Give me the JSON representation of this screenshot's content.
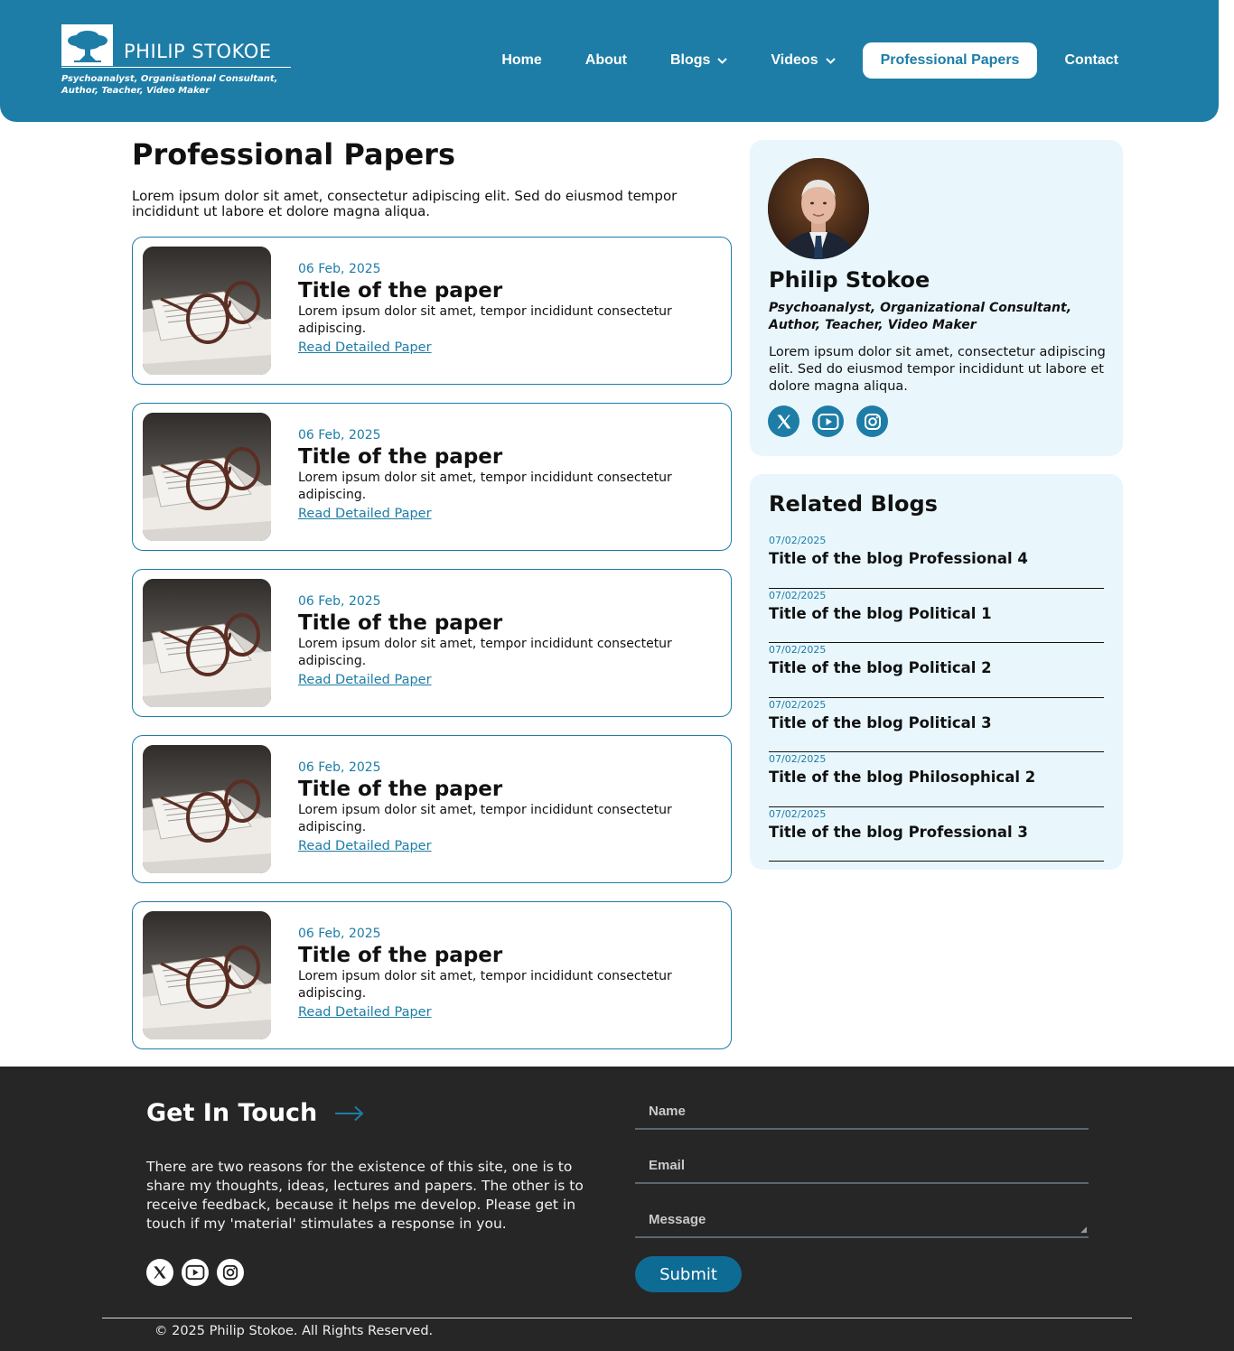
{
  "brand": {
    "name": "PHILIP STOKOE",
    "tagline": "Psychoanalyst, Organisational Consultant,\nAuthor, Teacher, Video Maker",
    "accent": "#1d7da6"
  },
  "nav": {
    "home": "Home",
    "about": "About",
    "blogs": "Blogs",
    "videos": "Videos",
    "papers": "Professional Papers",
    "contact": "Contact",
    "active": "Professional Papers"
  },
  "main": {
    "title": "Professional Papers",
    "intro": "Lorem ipsum dolor sit amet, consectetur adipiscing elit. Sed do eiusmod tempor incididunt ut labore et dolore magna aliqua.",
    "papers": [
      {
        "date": "06 Feb, 2025",
        "title": "Title of the paper",
        "excerpt": "Lorem ipsum dolor sit amet, tempor incididunt consectetur adipiscing.",
        "link": "Read Detailed Paper"
      },
      {
        "date": "06 Feb, 2025",
        "title": "Title of the paper",
        "excerpt": "Lorem ipsum dolor sit amet, tempor incididunt consectetur adipiscing.",
        "link": "Read Detailed Paper"
      },
      {
        "date": "06 Feb, 2025",
        "title": "Title of the paper",
        "excerpt": "Lorem ipsum dolor sit amet, tempor incididunt consectetur adipiscing.",
        "link": "Read Detailed Paper"
      },
      {
        "date": "06 Feb, 2025",
        "title": "Title of the paper",
        "excerpt": "Lorem ipsum dolor sit amet, tempor incididunt consectetur adipiscing.",
        "link": "Read Detailed Paper"
      },
      {
        "date": "06 Feb, 2025",
        "title": "Title of the paper",
        "excerpt": "Lorem ipsum dolor sit amet, tempor incididunt consectetur adipiscing.",
        "link": "Read Detailed Paper"
      }
    ]
  },
  "sidebar": {
    "profile": {
      "name": "Philip Stokoe",
      "role": "Psychoanalyst, Organizational Consultant, Author, Teacher, Video Maker",
      "bio": "Lorem ipsum dolor sit amet, consectetur adipiscing elit. Sed do eiusmod tempor incididunt ut labore et dolore magna aliqua.",
      "social_icons": [
        "x-icon",
        "youtube-icon",
        "instagram-icon"
      ]
    },
    "related": {
      "title": "Related Blogs",
      "items": [
        {
          "date": "07/02/2025",
          "title": "Title of the blog Professional 4"
        },
        {
          "date": "07/02/2025",
          "title": "Title of the blog Political 1"
        },
        {
          "date": "07/02/2025",
          "title": "Title of the blog Political 2"
        },
        {
          "date": "07/02/2025",
          "title": "Title of the blog Political 3"
        },
        {
          "date": "07/02/2025",
          "title": "Title of the blog Philosophical 2"
        },
        {
          "date": "07/02/2025",
          "title": "Title of the blog Professional 3"
        }
      ]
    }
  },
  "footer": {
    "title": "Get In Touch",
    "text": "There are two reasons for the existence of this site, one is to share my thoughts, ideas, lectures and papers. The other is to receive feedback, because it helps me develop. Please get in touch if my 'material' stimulates a response in you.",
    "form": {
      "name_placeholder": "Name",
      "email_placeholder": "Email",
      "message_placeholder": "Message",
      "submit": "Submit"
    },
    "copyright": "© 2025 Philip Stokoe. All Rights Reserved."
  }
}
